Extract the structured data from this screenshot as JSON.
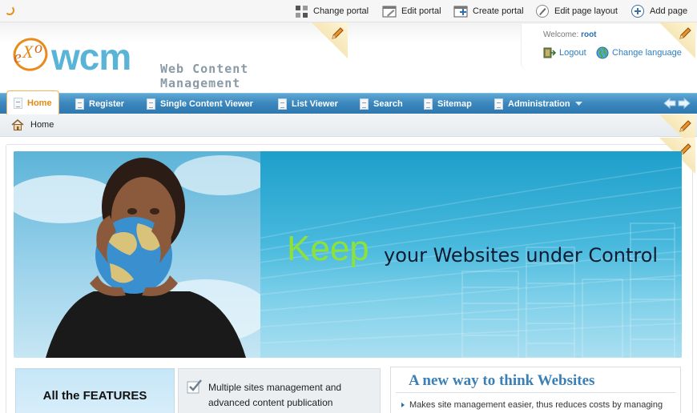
{
  "admin_bar": {
    "change_portal": "Change portal",
    "edit_portal": "Edit portal",
    "create_portal": "Create portal",
    "edit_page_layout": "Edit page layout",
    "add_page": "Add page"
  },
  "header": {
    "logo_exo": "eXo",
    "logo_wcm": "wcm",
    "logo_subtitle_line1": "Web Content",
    "logo_subtitle_line2": "Management",
    "welcome_label": "Welcome:",
    "username": "root",
    "logout": "Logout",
    "change_language": "Change language"
  },
  "nav": {
    "items": [
      {
        "label": "Home"
      },
      {
        "label": "Register"
      },
      {
        "label": "Single Content Viewer"
      },
      {
        "label": "List Viewer"
      },
      {
        "label": "Search"
      },
      {
        "label": "Sitemap"
      },
      {
        "label": "Administration"
      }
    ],
    "active_index": 0
  },
  "breadcrumb": {
    "home": "Home"
  },
  "banner": {
    "keep": "Keep",
    "tagline": "your Websites under Control"
  },
  "features": {
    "title": "All the FEATURES",
    "item_text": "Multiple sites management and advanced content publication"
  },
  "news": {
    "title": "A new way to think Websites",
    "item": "Makes site management easier, thus reduces costs by managing"
  },
  "colors": {
    "nav_blue": "#3a86bd",
    "active_orange": "#e08a17",
    "keep_green": "#8de23a",
    "link_blue": "#2a7fc4",
    "news_title_blue": "#3a7fb5"
  }
}
